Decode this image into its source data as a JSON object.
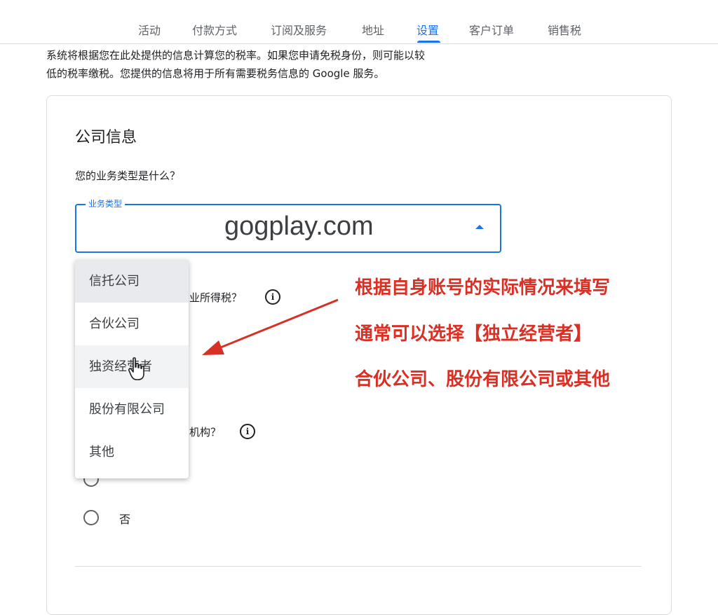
{
  "nav": {
    "tabs": [
      "活动",
      "付款方式",
      "订阅及服务",
      "地址",
      "设置",
      "客户订单",
      "销售税"
    ],
    "active_index": 4
  },
  "intro": {
    "line1": "系统将根据您在此处提供的信息计算您的税率。如果您申请免税身份，则可能以较",
    "line2": "低的税率缴税。您提供的信息将用于所有需要税务信息的 Google 服务。"
  },
  "company": {
    "title": "公司信息",
    "business_type_question": "您的业务类型是什么？",
    "business_type_field": {
      "label": "业务类型",
      "value": "gogplay.com"
    },
    "question2_partial": "业所得税？",
    "question3_partial": "机构？",
    "radio_no_label": "否"
  },
  "dropdown": {
    "options": [
      "信托公司",
      "合伙公司",
      "独资经营者",
      "股份有限公司",
      "其他"
    ],
    "selected_index": 0,
    "hover_index": 2
  },
  "annotation": {
    "line1": "根据自身账号的实际情况来填写",
    "line2": "通常可以选择【独立经营者】",
    "line3": "合伙公司、股份有限公司或其他",
    "color": "#d93025"
  },
  "colors": {
    "accent": "#1a73e8",
    "text": "#202124",
    "muted": "#5f6368"
  }
}
